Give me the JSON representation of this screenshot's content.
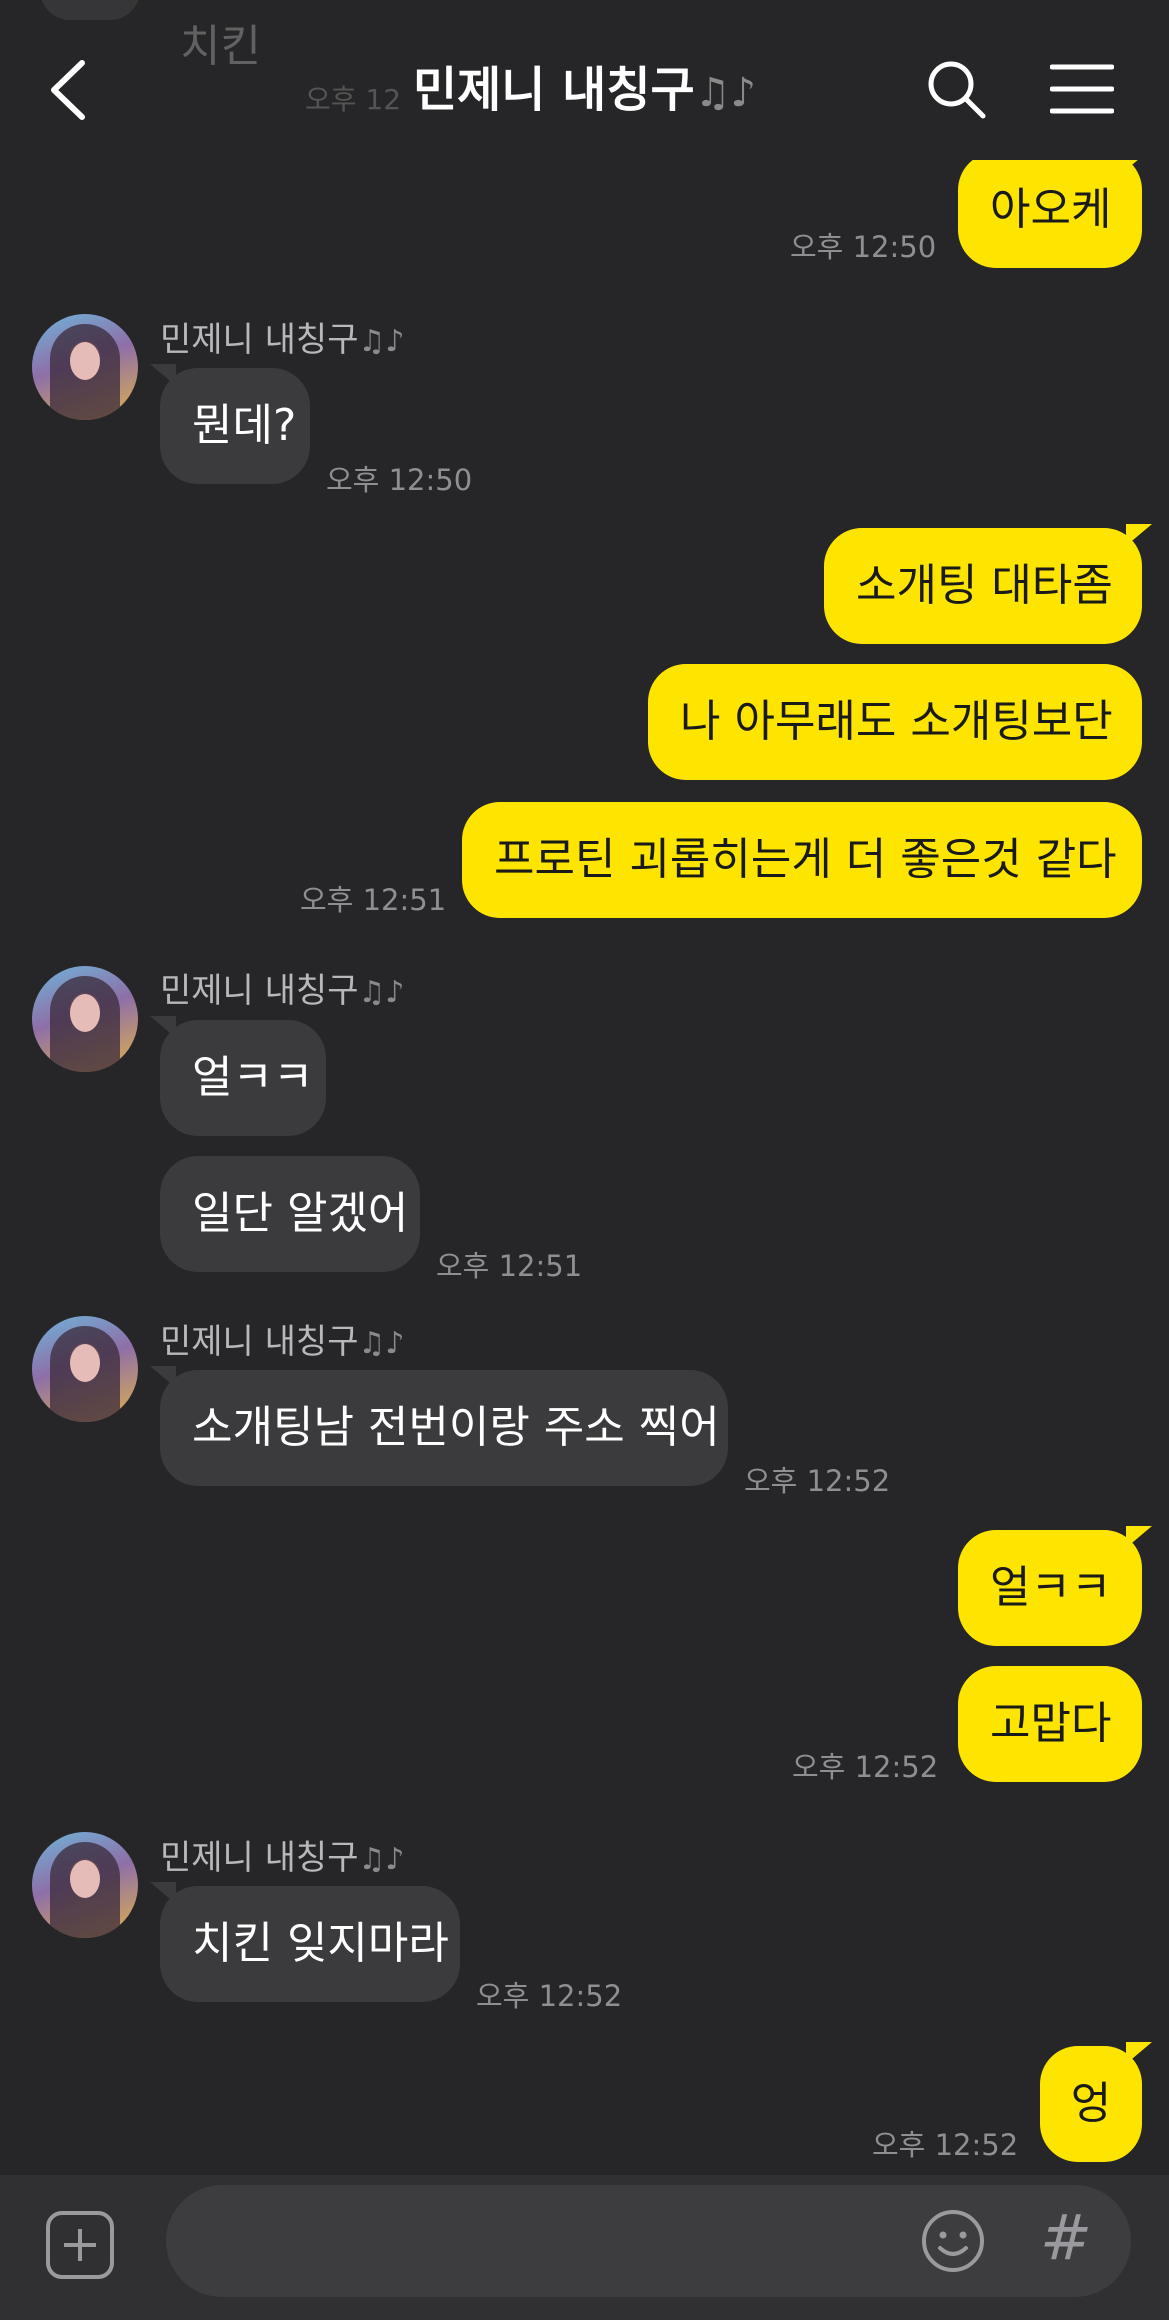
{
  "header": {
    "title": "민제니 내칭구",
    "title_suffix": "♫♪",
    "back_icon": "chevron-left-icon",
    "search_icon": "search-icon",
    "menu_icon": "hamburger-menu-icon",
    "ghost_message": "치킨",
    "ghost_time": "오후 12"
  },
  "friend": {
    "name": "민제니 내칭구",
    "name_suffix": "♫♪"
  },
  "messages": [
    {
      "text": "아오케",
      "time": "오후 12:50"
    },
    {
      "text": "뭔데?",
      "time": "오후 12:50"
    },
    {
      "text": "소개팅 대타좀"
    },
    {
      "text": "나 아무래도 소개팅보단"
    },
    {
      "text": "프로틴 괴롭히는게 더 좋은것 같다",
      "time": "오후 12:51"
    },
    {
      "text": "얼ㅋㅋ"
    },
    {
      "text": "일단 알겠어",
      "time": "오후 12:51"
    },
    {
      "text": "소개팅남 전번이랑 주소 찍어",
      "time": "오후 12:52"
    },
    {
      "text": "얼ㅋㅋ"
    },
    {
      "text": "고맙다",
      "time": "오후 12:52"
    },
    {
      "text": "치킨 잊지마라",
      "time": "오후 12:52"
    },
    {
      "text": "엉",
      "time": "오후 12:52"
    }
  ],
  "input": {
    "placeholder": "",
    "plus_icon": "plus-square-icon",
    "emoji_icon": "smiley-icon",
    "hash_icon": "hashtag-icon",
    "hash_glyph": "#"
  },
  "colors": {
    "background": "#262628",
    "my_bubble": "#fee500",
    "their_bubble": "#3b3b3e"
  }
}
